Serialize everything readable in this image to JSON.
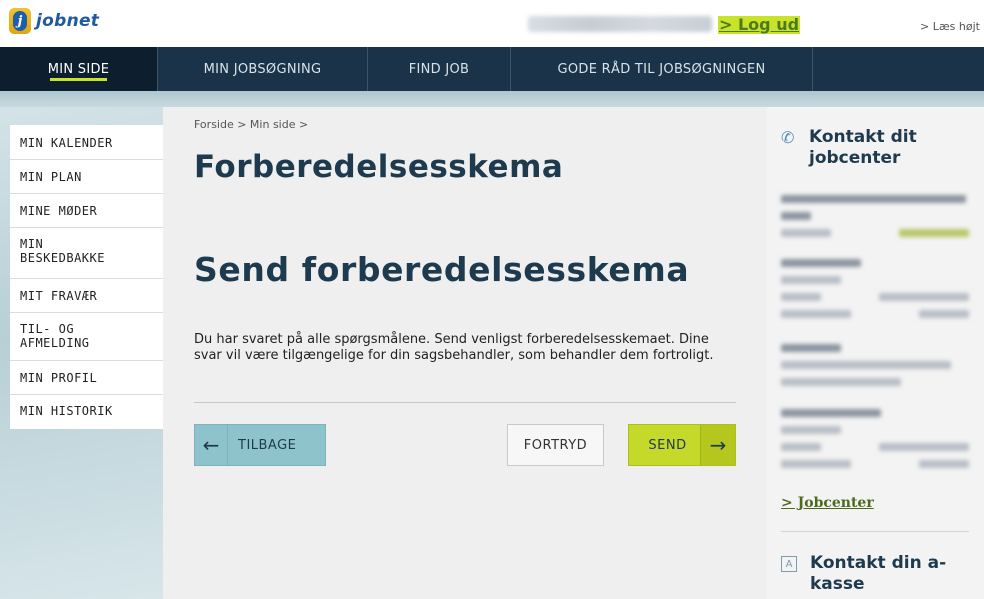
{
  "header": {
    "logo_text": "jobnet",
    "logo_letter": "j",
    "logout_label": "> Log ud",
    "read_aloud_label": "> Læs højt"
  },
  "nav": {
    "items": [
      {
        "label": "MIN SIDE"
      },
      {
        "label": "MIN JOBSØGNING"
      },
      {
        "label": "FIND JOB"
      },
      {
        "label": "GODE RÅD TIL JOBSØGNINGEN"
      }
    ]
  },
  "sidebar": {
    "items": [
      {
        "label": "MIN KALENDER"
      },
      {
        "label": "MIN PLAN"
      },
      {
        "label": "MINE MØDER"
      },
      {
        "label": "MIN\nBESKEDBAKKE"
      },
      {
        "label": "MIT FRAVÆR"
      },
      {
        "label": "TIL- OG\nAFMELDING"
      },
      {
        "label": "MIN PROFIL"
      },
      {
        "label": "MIN HISTORIK"
      }
    ]
  },
  "main": {
    "breadcrumb": "Forside > Min side >",
    "title": "Forberedelsesskema",
    "section_title": "Send forberedelsesskema",
    "body": "Du har svaret på alle spørgsmålene. Send venligst forberedelsesskemaet. Dine svar vil være tilgængelige for din sagsbehandler, som behandler dem fortroligt.",
    "back_label": "TILBAGE",
    "cancel_label": "FORTRYD",
    "send_label": "SEND"
  },
  "right": {
    "contact_title": "Kontakt dit jobcenter",
    "jobcenter_link": "> Jobcenter",
    "akasse_title": "Kontakt din a-kasse"
  },
  "colors": {
    "nav_bg": "#1a3348",
    "accent_green": "#c9e32a",
    "title_color": "#1e3a4f",
    "back_button": "#8fc3cc",
    "send_button": "#c5d92a"
  }
}
